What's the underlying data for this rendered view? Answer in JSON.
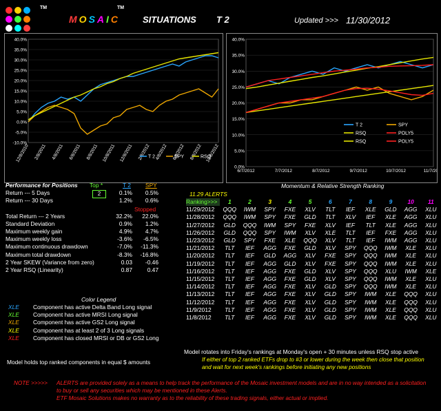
{
  "header": {
    "brand_letters": [
      {
        "ch": "M",
        "color": "#ff3b3b"
      },
      {
        "ch": "O",
        "color": "#ffd400"
      },
      {
        "ch": "S",
        "color": "#00c8ff"
      },
      {
        "ch": "A",
        "color": "#ff00ff"
      },
      {
        "ch": "I",
        "color": "#66ff33"
      },
      {
        "ch": "C",
        "color": "#ff8000"
      }
    ],
    "tm": "TM",
    "situations": "SITUATIONS",
    "t2": "T 2",
    "updated_label": "Updated >>>",
    "updated_date": "11/30/2012",
    "logo_colors": [
      "#ff3030",
      "#ffd000",
      "#00b0ff",
      "#ff00ff",
      "#40ff40",
      "#ff8000",
      "#ffffff",
      "#00ffff",
      "#ff4040"
    ]
  },
  "chart_data": [
    {
      "type": "line",
      "ylim": [
        -10,
        40
      ],
      "yticks": [
        "40.0%",
        "35.0%",
        "30.0%",
        "25.0%",
        "20.0%",
        "15.0%",
        "10.0%",
        "5.0%",
        "0.0%",
        "-5.0%",
        "-10.0%"
      ],
      "xticks": [
        "12/8/2010",
        "2/8/2011",
        "4/8/2011",
        "6/8/2011",
        "8/8/2011",
        "10/8/2011",
        "12/8/2011",
        "2/8/2012",
        "4/8/2012",
        "6/8/2012",
        "8/8/2012",
        "10/8/2012"
      ],
      "legend": [
        "T 2",
        "SPY",
        "RSQ"
      ],
      "series": [
        {
          "name": "T 2",
          "color": "#2aa6ff",
          "values": [
            0,
            4,
            7,
            9,
            10,
            12,
            11,
            12,
            10,
            13,
            16,
            18,
            19,
            20,
            21,
            22,
            22,
            23,
            24,
            25,
            26,
            27,
            28,
            27,
            29,
            30,
            31,
            32,
            32,
            31
          ]
        },
        {
          "name": "SPY",
          "color": "#f0a800",
          "values": [
            0,
            3,
            5,
            7,
            8,
            7,
            6,
            4,
            -3,
            -6,
            -4,
            -2,
            -1,
            2,
            3,
            6,
            7,
            8,
            6,
            5,
            8,
            10,
            11,
            13,
            14,
            15,
            16,
            14,
            12,
            16
          ]
        },
        {
          "name": "RSQ",
          "color": "#e6e600",
          "values": [
            1,
            3,
            4.5,
            6,
            7.5,
            9,
            10.5,
            12,
            13,
            14.5,
            16,
            17,
            18.5,
            19.5,
            21,
            22,
            23.5,
            24.5,
            25.5,
            26.5,
            27.5,
            28.5,
            29.5,
            30.5,
            31,
            31.5,
            32,
            32.5,
            33,
            33.5
          ]
        }
      ]
    },
    {
      "type": "line",
      "ylim": [
        0,
        40
      ],
      "yticks": [
        "40.0%",
        "35.0%",
        "30.0%",
        "25.0%",
        "20.0%",
        "15.0%",
        "10.0%",
        "5.0%",
        "0.0%"
      ],
      "xticks": [
        "6/7/2012",
        "7/7/2012",
        "8/7/2012",
        "9/7/2012",
        "10/7/2012",
        "11/7/2012"
      ],
      "legend": [
        {
          "name": "T 2",
          "color": "#2aa6ff"
        },
        {
          "name": "SPY",
          "color": "#f0a800"
        },
        {
          "name": "RSQ",
          "color": "#e6e600"
        },
        {
          "name": "POLY5",
          "color": "#ff2020"
        },
        {
          "name": "RSQ",
          "color": "#e6e600"
        },
        {
          "name": "POLY5",
          "color": "#ff2020"
        }
      ],
      "series": [
        {
          "name": "T 2",
          "color": "#2aa6ff",
          "values": [
            25,
            26,
            27,
            26,
            28,
            29,
            30,
            29,
            31,
            30,
            31,
            32,
            31,
            32,
            33,
            32,
            31,
            32
          ]
        },
        {
          "name": "SPY",
          "color": "#f0a800",
          "values": [
            17,
            18,
            19,
            20,
            20,
            21,
            21,
            22,
            23,
            24,
            25,
            24,
            25,
            23,
            22,
            21,
            22,
            24
          ]
        },
        {
          "name": "RSQ",
          "color": "#e6e600",
          "values": [
            24.5,
            25,
            25.6,
            26.2,
            26.8,
            27.4,
            28,
            28.5,
            29.1,
            29.7,
            30.3,
            30.9,
            31.4,
            32,
            32.6,
            33.2,
            33.8,
            34.3
          ]
        },
        {
          "name": "POLY5",
          "color": "#ff2020",
          "values": [
            25,
            26,
            27,
            27.5,
            28,
            28.5,
            29,
            29.5,
            30,
            30.3,
            30.6,
            31,
            31.2,
            31.5,
            31.6,
            31.7,
            31.8,
            32
          ]
        },
        {
          "name": "RSQ",
          "color": "#e6e600",
          "values": [
            17,
            17.5,
            18,
            18.5,
            19,
            19.5,
            20,
            20.5,
            21,
            21.5,
            22,
            22.5,
            23,
            23.5,
            24,
            24.5,
            25,
            25.5
          ]
        },
        {
          "name": "POLY5",
          "color": "#ff2020",
          "values": [
            17,
            18,
            19,
            20,
            20.5,
            21,
            21.5,
            22,
            23,
            24,
            24.5,
            24.6,
            24.3,
            23.8,
            23.2,
            22.6,
            22.4,
            23
          ]
        }
      ]
    }
  ],
  "perf": {
    "title": "Performance for Positions",
    "top_label": "Top *",
    "t2_label": "T 2",
    "spy_label": "SPY",
    "top_value": "2",
    "stopped": "Stopped",
    "rows": [
      {
        "label": "Return --- 5 Days",
        "t2": "0.1%",
        "spy": "0.5%"
      },
      {
        "label": "Return --- 30 Days",
        "t2": "1.2%",
        "spy": "0.6%"
      },
      {
        "label": "Total Return --- 2 Years",
        "t2": "32.2%",
        "spy": "22.0%"
      },
      {
        "label": "Standard Deviation",
        "t2": "0.9%",
        "spy": "1.2%"
      },
      {
        "label": "Maximum weekly gain",
        "t2": "4.9%",
        "spy": "4.7%"
      },
      {
        "label": "Maximum weekly loss",
        "t2": "-3.6%",
        "spy": "-6.5%"
      },
      {
        "label": "Maximum continuous drawdown",
        "t2": "-7.0%",
        "spy": "-11.3%"
      },
      {
        "label": "Maximum total drawdown",
        "t2": "-8.3%",
        "spy": "-16.8%"
      },
      {
        "label": "2 Year SKEW  (Variance from zero)",
        "t2": "0.03",
        "spy": "-0.46"
      },
      {
        "label": "2 Year RSQ  (Linearity)",
        "t2": "0.87",
        "spy": "0.47"
      }
    ]
  },
  "legend": {
    "title": "Color Legend",
    "items": [
      {
        "tag": "XLE",
        "color": "#2aa6ff",
        "text": "Component has active Delta Band Long signal"
      },
      {
        "tag": "XLE",
        "color": "#66ff33",
        "text": "Component has active MRSI Long signal"
      },
      {
        "tag": "XLE",
        "color": "#f0a800",
        "text": "Component has active GS2 Long signal"
      },
      {
        "tag": "XLE",
        "color": "#ffff00",
        "text": "Component has at least 2 of 3 Long signals"
      },
      {
        "tag": "XLE",
        "color": "#ff2020",
        "text": "Component has closed MRSI or DB or GS2 Long"
      }
    ]
  },
  "holds_note": "Model holds top ranked  components in equal  $ amounts",
  "ranking": {
    "title": "Momentum & Relative Strength Ranking",
    "alerts": "11.29 ALERTS",
    "header_label": "Ranking>>>",
    "columns": [
      "1",
      "2",
      "3",
      "4",
      "5",
      "6",
      "7",
      "8",
      "9",
      "10",
      "11"
    ],
    "column_colors": [
      "#66ff33",
      "#66ff33",
      "#ffff00",
      "#66ff33",
      "#66ff33",
      "#2aa6ff",
      "#2aa6ff",
      "#2aa6ff",
      "#2aa6ff",
      "#ff00ff",
      "#ff00ff"
    ],
    "rows": [
      {
        "date": "11/29/2012",
        "t": [
          "QQQ",
          "IWM",
          "SPY",
          "FXE",
          "XLV",
          "TLT",
          "IEF",
          "XLE",
          "GLD",
          "AGG",
          "XLU"
        ]
      },
      {
        "date": "11/28/2012",
        "t": [
          "QQQ",
          "IWM",
          "SPY",
          "FXE",
          "GLD",
          "TLT",
          "XLV",
          "IEF",
          "XLE",
          "AGG",
          "XLU"
        ]
      },
      {
        "date": "11/27/2012",
        "t": [
          "GLD",
          "QQQ",
          "IWM",
          "SPY",
          "FXE",
          "XLV",
          "IEF",
          "TLT",
          "XLE",
          "AGG",
          "XLU"
        ]
      },
      {
        "date": "11/26/2012",
        "t": [
          "GLD",
          "QQQ",
          "SPY",
          "IWM",
          "XLV",
          "XLE",
          "TLT",
          "IEF",
          "FXE",
          "AGG",
          "XLU"
        ]
      },
      {
        "date": "11/23/2012",
        "t": [
          "GLD",
          "SPY",
          "FXE",
          "XLE",
          "QQQ",
          "XLV",
          "TLT",
          "IEF",
          "IWM",
          "AGG",
          "XLU"
        ]
      },
      {
        "date": "11/21/2012",
        "t": [
          "TLT",
          "IEF",
          "AGG",
          "FXE",
          "GLD",
          "XLV",
          "SPY",
          "QQQ",
          "IWM",
          "XLE",
          "XLU"
        ]
      },
      {
        "date": "11/20/2012",
        "t": [
          "TLT",
          "IEF",
          "GLD",
          "AGG",
          "XLV",
          "FXE",
          "SPY",
          "QQQ",
          "IWM",
          "XLE",
          "XLU"
        ]
      },
      {
        "date": "11/19/2012",
        "t": [
          "TLT",
          "IEF",
          "AGG",
          "GLD",
          "XLV",
          "FXE",
          "SPY",
          "QQQ",
          "IWM",
          "XLE",
          "XLU"
        ]
      },
      {
        "date": "11/16/2012",
        "t": [
          "TLT",
          "IEF",
          "AGG",
          "FXE",
          "GLD",
          "XLV",
          "SPY",
          "QQQ",
          "XLU",
          "IWM",
          "XLE"
        ]
      },
      {
        "date": "11/15/2012",
        "t": [
          "TLT",
          "IEF",
          "AGG",
          "FXE",
          "GLD",
          "XLV",
          "SPY",
          "QQQ",
          "IWM",
          "XLE",
          "XLU"
        ]
      },
      {
        "date": "11/14/2012",
        "t": [
          "TLT",
          "IEF",
          "AGG",
          "FXE",
          "XLV",
          "GLD",
          "SPY",
          "QQQ",
          "IWM",
          "XLE",
          "XLU"
        ]
      },
      {
        "date": "11/13/2012",
        "t": [
          "TLT",
          "IEF",
          "AGG",
          "FXE",
          "XLV",
          "GLD",
          "SPY",
          "IWM",
          "XLE",
          "QQQ",
          "XLU"
        ]
      },
      {
        "date": "11/12/2012",
        "t": [
          "TLT",
          "IEF",
          "AGG",
          "FXE",
          "XLV",
          "GLD",
          "SPY",
          "IWM",
          "XLE",
          "QQQ",
          "XLU"
        ]
      },
      {
        "date": "11/9/2012",
        "t": [
          "TLT",
          "IEF",
          "AGG",
          "FXE",
          "XLV",
          "GLD",
          "SPY",
          "IWM",
          "XLE",
          "QQQ",
          "XLU"
        ]
      },
      {
        "date": "11/8/2012",
        "t": [
          "TLT",
          "IEF",
          "AGG",
          "FXE",
          "XLV",
          "GLD",
          "SPY",
          "IWM",
          "XLE",
          "QQQ",
          "XLU"
        ]
      }
    ]
  },
  "notes": {
    "rotate": "Model rotates into Friday's rankings at Monday's open + 30 minutes unless RSQ stop active",
    "stop1": "If either of top 2 ranked ETFs drop to #3 or lower during the week then close that position",
    "stop2": "and wait for next week's rankings before initiating any new positions",
    "note_label": "NOTE >>>>>",
    "disc1": "ALERTS are provided solely as a means to help track the performance of the Mosaic investment models and are in no way intended as a solicitation",
    "disc2": "to buy or sell any securities which may be mentioned in these Alerts.",
    "disc3": "ETF Mosaic Solutions makes no warranty as to the reliability of these trading signals, either actual or implied."
  }
}
